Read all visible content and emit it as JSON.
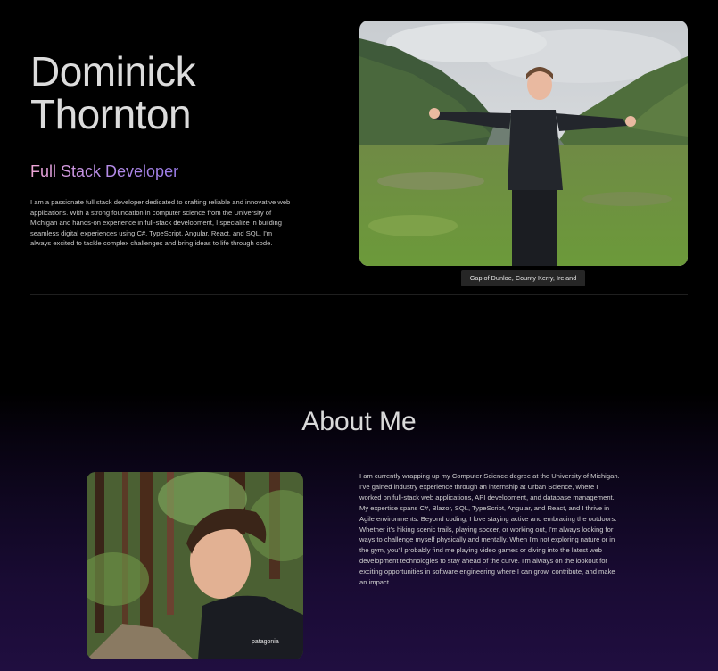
{
  "hero": {
    "name_first": "Dominick",
    "name_last": "Thornton",
    "role": "Full Stack Developer",
    "bio": "I am a passionate full stack developer dedicated to crafting reliable and innovative web applications. With a strong foundation in computer science from the University of Michigan and hands-on experience in full-stack development, I specialize in building seamless digital experiences using C#, TypeScript, Angular, React, and SQL. I'm always excited to tackle complex challenges and bring ideas to life through code.",
    "photo_caption": "Gap of Dunloe, County Kerry, Ireland"
  },
  "about": {
    "heading": "About Me",
    "text": "I am currently wrapping up my Computer Science degree at the University of Michigan. I've gained industry experience through an internship at Urban Science, where I worked on full-stack web applications, API development, and database management. My expertise spans C#, Blazor, SQL, TypeScript, Angular, and React, and I thrive in Agile environments. Beyond coding, I love staying active and embracing the outdoors. Whether it's hiking scenic trails, playing soccer, or working out, I'm always looking for ways to challenge myself physically and mentally. When I'm not exploring nature or in the gym, you'll probably find me playing video games or diving into the latest web development technologies to stay ahead of the curve. I'm always on the lookout for exciting opportunities in software engineering where I can grow, contribute, and make an impact.",
    "shirt_logo": "patagonia"
  },
  "colors": {
    "page_background": "#000000",
    "gradient_bottom": "#200e40",
    "role_gradient_start": "#f0a6d6",
    "role_gradient_end": "#9a7ce8",
    "caption_background": "#262626"
  }
}
